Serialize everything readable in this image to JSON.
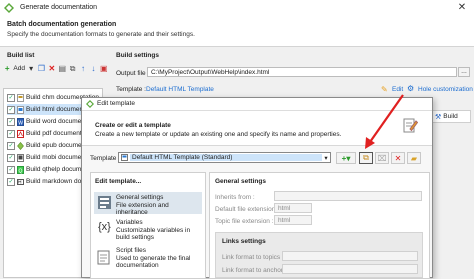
{
  "window": {
    "title": "Generate documentation"
  },
  "header": {
    "title": "Batch documentation generation",
    "subtitle": "Specify the documentation formats to generate and their settings."
  },
  "build_list": {
    "label": "Build list",
    "add_label": "Add",
    "items": [
      {
        "label": "Build chm documentation",
        "checked": true,
        "selected": false,
        "icon": "chm-icon"
      },
      {
        "label": "Build html documentation",
        "checked": true,
        "selected": true,
        "icon": "html-icon"
      },
      {
        "label": "Build word documentation",
        "checked": true,
        "selected": false,
        "icon": "word-icon"
      },
      {
        "label": "Build pdf documentation",
        "checked": true,
        "selected": false,
        "icon": "pdf-icon"
      },
      {
        "label": "Build epub documentation",
        "checked": true,
        "selected": false,
        "icon": "epub-icon"
      },
      {
        "label": "Build mobi documentation",
        "checked": true,
        "selected": false,
        "icon": "mobi-icon"
      },
      {
        "label": "Build qthelp documentation",
        "checked": true,
        "selected": false,
        "icon": "qthelp-icon"
      },
      {
        "label": "Build markdown documentation",
        "checked": true,
        "selected": false,
        "icon": "markdown-icon"
      }
    ]
  },
  "build_settings": {
    "label": "Build settings",
    "output_label": "Output file :",
    "output_value": "C:\\MyProject\\Output\\WebHelp\\index.html",
    "template_label": "Template :",
    "template_link": "Default HTML Template",
    "edit_label": "Edit",
    "hole_label": "Hole customization",
    "build_label": "Build"
  },
  "dialog": {
    "title": "Edit template",
    "heading": "Create or edit a template",
    "subheading": "Create a new template or update an existing one and specify its name and properties.",
    "template_label": "Template :",
    "template_value": "Default HTML Template (Standard)",
    "edit_template_label": "Edit template...",
    "nav_items": [
      {
        "title": "General settings",
        "desc": "File extension and inheritance",
        "icon": "settings-icon"
      },
      {
        "title": "Variables",
        "desc": "Customizable variables in build settings",
        "icon": "variables-icon"
      },
      {
        "title": "Script files",
        "desc": "Used to generate the final documentation",
        "icon": "script-icon"
      }
    ],
    "general_label": "General settings",
    "inherits_label": "Inherits from :",
    "default_ext_label": "Default file extension :",
    "default_ext_value": "html",
    "topic_ext_label": "Topic file extension :",
    "topic_ext_value": "html",
    "links_label": "Links settings",
    "link_topics_label": "Link format to topics :",
    "link_anchors_label": "Link format to anchors :"
  },
  "colors": {
    "accent": "#1c6dd0",
    "arrow": "#e02020",
    "selection": "#cde4fa"
  }
}
